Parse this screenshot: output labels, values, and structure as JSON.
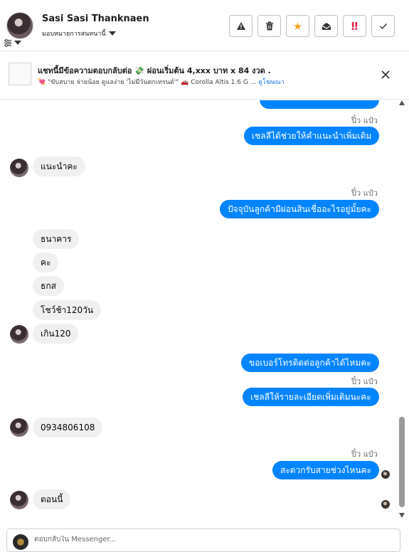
{
  "header": {
    "name": "Sasi Sasi Thanknaen",
    "assign_label": "มอบหมายการสนทนานี้",
    "actions": [
      {
        "icon": "warning-icon",
        "symbol": "⚠"
      },
      {
        "icon": "trash-icon",
        "symbol": "🗑"
      },
      {
        "icon": "star-icon",
        "symbol": "★",
        "color": "#f5a623"
      },
      {
        "icon": "envelope-open-icon",
        "symbol": "✉"
      },
      {
        "icon": "double-exclamation-icon",
        "symbol": "‼",
        "color": "#e41e3f"
      },
      {
        "icon": "check-icon",
        "symbol": "✓"
      }
    ]
  },
  "ad": {
    "title": "แชทนี้มีข้อความตอบกลับต่อ 💸 ผ่อนเริ่มต้น 4,xxx บาท x 84 งวด .",
    "subtitle": "💘 \"ขับสบาย จ่ายน้อย ดูแลง่าย 'ไม่มีวันตกเทรนด์'\" 🚗 Corolla Altis 1.6 G ...",
    "link": "ดูโฆษณา"
  },
  "messages": {
    "sender_1": "ปิ๋ว แป๋ว",
    "out_1": "เชลลีได้ช่วยให้คำแนะนำเพิ่มเติม",
    "in_1": "แนะนำคะ",
    "sender_2": "ปิ๋ว แป๋ว",
    "out_2": "ปัจจุบันลูกค้ามีผ่อนสินเชื่ออะไรอยู่มั้ยคะ",
    "in_2": "ธนาคาร",
    "in_3": "คะ",
    "in_4": "ธกส",
    "in_5": "โชว์ช้า120วัน",
    "in_6": "เกิน120",
    "out_3": "ขอเบอร์โทรติดต่อลูกค้าได้ไหมคะ",
    "sender_3": "ปิ๋ว แป๋ว",
    "out_4": "เชลลีให้รายละเอียดเพิ่มเติมนะคะ",
    "in_7": "0934806108",
    "sender_4": "ปิ๋ว แป๋ว",
    "out_5": "สะดวกรับสายช่วงไหนคะ",
    "in_8": "ตอนนี้"
  },
  "composer": {
    "placeholder": "ตอบกลับใน Messenger..."
  },
  "colors": {
    "outgoing_bubble": "#0084ff",
    "incoming_bubble": "#f0f0f0",
    "link": "#1b74e4"
  }
}
